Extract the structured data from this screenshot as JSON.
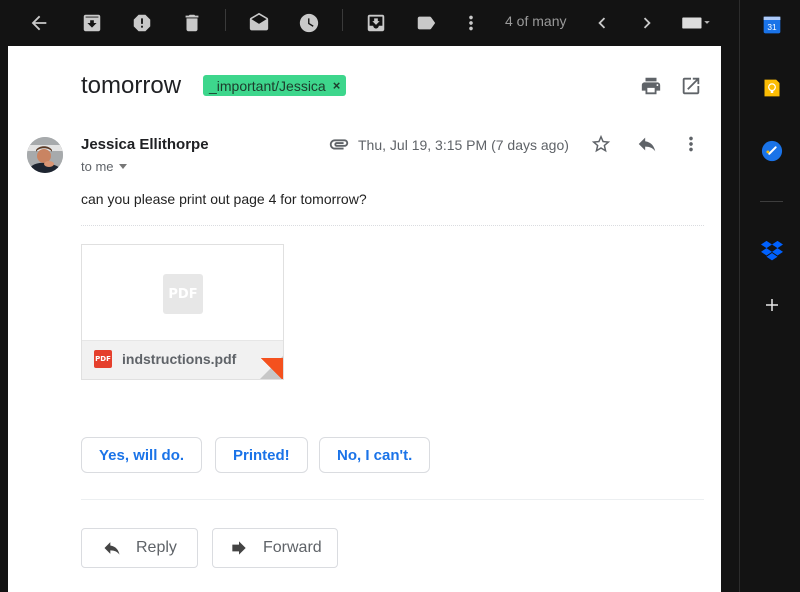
{
  "toolbar": {
    "icons": [
      "back-arrow-icon",
      "archive-icon",
      "report-spam-icon",
      "delete-icon",
      "mark-unread-icon",
      "snooze-icon",
      "move-to-icon",
      "label-icon",
      "more-vert-icon"
    ],
    "counter": "4 of many",
    "prev_icon": "chevron-left-icon",
    "next_icon": "chevron-right-icon",
    "input_tools_icon": "keyboard-icon"
  },
  "sidebar": {
    "apps": [
      {
        "name": "calendar",
        "label": "31",
        "color": "#1a73e8"
      },
      {
        "name": "keep",
        "color": "#fbbc04"
      },
      {
        "name": "tasks",
        "color": "#1a73e8"
      },
      {
        "name": "dropbox",
        "color": "#0061fe"
      },
      {
        "name": "add-addon"
      }
    ]
  },
  "email": {
    "subject": "tomorrow",
    "label": "_important/Jessica",
    "label_remove": "×",
    "label_color": "#3dd68c",
    "sender": "Jessica Ellithorpe",
    "recipient": "to me",
    "date": "Thu, Jul 19, 3:15 PM (7 days ago)",
    "body": "can you please print out page 4 for tomorrow?",
    "attachment": {
      "preview_badge": "PDF",
      "type_badge": "PDF",
      "filename": "indstructions.pdf"
    },
    "smart_replies": [
      "Yes, will do.",
      "Printed!",
      "No, I can't."
    ],
    "actions": {
      "reply": "Reply",
      "forward": "Forward"
    }
  },
  "colors": {
    "accent": "#1a73e8",
    "background": "#131313"
  }
}
